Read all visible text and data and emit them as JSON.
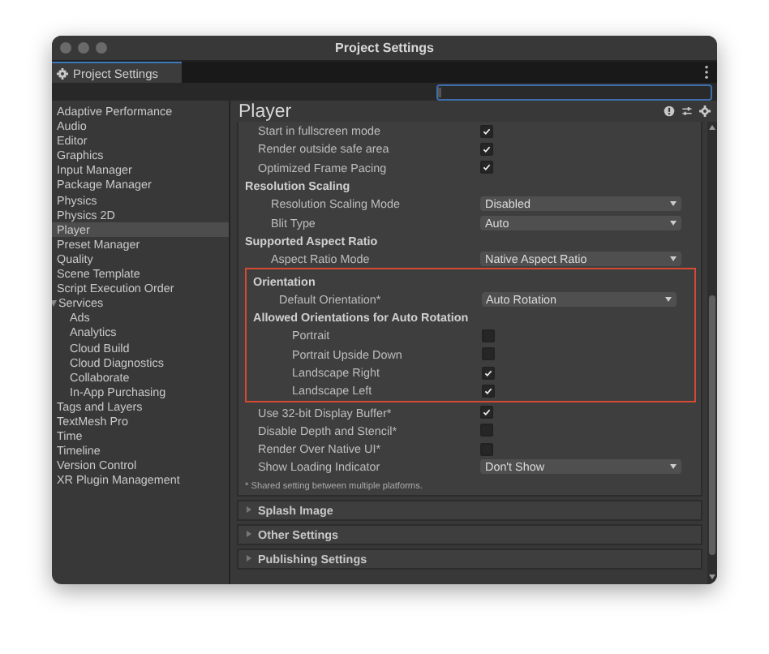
{
  "window": {
    "title": "Project Settings"
  },
  "tab": {
    "label": "Project Settings"
  },
  "search": {
    "kind": "empty"
  },
  "sidebar": {
    "items": [
      {
        "label": "Adaptive Performance",
        "selected": false
      },
      {
        "label": "Audio",
        "selected": false
      },
      {
        "label": "Editor",
        "selected": false
      },
      {
        "label": "Graphics",
        "selected": false
      },
      {
        "label": "Input Manager",
        "selected": false
      },
      {
        "label": "Package Manager",
        "selected": false
      },
      {
        "label": "Physics",
        "selected": false
      },
      {
        "label": "Physics 2D",
        "selected": false
      },
      {
        "label": "Player",
        "selected": true
      },
      {
        "label": "Preset Manager",
        "selected": false
      },
      {
        "label": "Quality",
        "selected": false
      },
      {
        "label": "Scene Template",
        "selected": false
      },
      {
        "label": "Script Execution Order",
        "selected": false
      },
      {
        "label": "Services",
        "selected": false,
        "expanded": true,
        "children": [
          {
            "label": "Ads",
            "selected": false
          },
          {
            "label": "Analytics",
            "selected": false
          },
          {
            "label": "Cloud Build",
            "selected": false
          },
          {
            "label": "Cloud Diagnostics",
            "selected": false
          },
          {
            "label": "Collaborate",
            "selected": false
          },
          {
            "label": "In-App Purchasing",
            "selected": false
          }
        ]
      },
      {
        "label": "Tags and Layers",
        "selected": false
      },
      {
        "label": "TextMesh Pro",
        "selected": false
      },
      {
        "label": "Time",
        "selected": false
      },
      {
        "label": "Timeline",
        "selected": false
      },
      {
        "label": "Version Control",
        "selected": false
      },
      {
        "label": "XR Plugin Management",
        "selected": false
      }
    ]
  },
  "panel": {
    "title": "Player",
    "settings": [
      {
        "kind": "checkbox",
        "label": "Start in fullscreen mode",
        "checked": true
      },
      {
        "kind": "checkbox",
        "label": "Render outside safe area",
        "checked": true
      },
      {
        "kind": "checkbox",
        "label": "Optimized Frame Pacing",
        "checked": true
      },
      {
        "kind": "header",
        "label": "Resolution Scaling",
        "children": [
          {
            "kind": "dropdown",
            "label": "Resolution Scaling Mode",
            "value": "Disabled"
          },
          {
            "kind": "dropdown",
            "label": "Blit Type",
            "value": "Auto"
          }
        ]
      },
      {
        "kind": "header",
        "label": "Supported Aspect Ratio",
        "children": [
          {
            "kind": "dropdown",
            "label": "Aspect Ratio Mode",
            "value": "Native Aspect Ratio"
          }
        ]
      },
      {
        "kind": "highlight",
        "children": [
          {
            "kind": "header",
            "label": "Orientation",
            "children": [
              {
                "kind": "dropdown",
                "label": "Default Orientation*",
                "value": "Auto Rotation"
              },
              {
                "kind": "header",
                "label": "Allowed Orientations for Auto Rotation",
                "children": [
                  {
                    "kind": "checkbox",
                    "label": "Portrait",
                    "checked": false
                  },
                  {
                    "kind": "checkbox",
                    "label": "Portrait Upside Down",
                    "checked": false
                  },
                  {
                    "kind": "checkbox",
                    "label": "Landscape Right",
                    "checked": true
                  },
                  {
                    "kind": "checkbox",
                    "label": "Landscape Left",
                    "checked": true
                  }
                ]
              }
            ]
          }
        ]
      },
      {
        "kind": "checkbox",
        "label": "Use 32-bit Display Buffer*",
        "checked": true
      },
      {
        "kind": "checkbox",
        "label": "Disable Depth and Stencil*",
        "checked": false
      },
      {
        "kind": "checkbox",
        "label": "Render Over Native UI*",
        "checked": false
      },
      {
        "kind": "dropdown",
        "label": "Show Loading Indicator",
        "value": "Don't Show"
      }
    ],
    "note": "* Shared setting between multiple platforms.",
    "foldouts": [
      {
        "label": "Splash Image",
        "expanded": false
      },
      {
        "label": "Other Settings",
        "expanded": false
      },
      {
        "label": "Publishing Settings",
        "expanded": false
      }
    ]
  }
}
